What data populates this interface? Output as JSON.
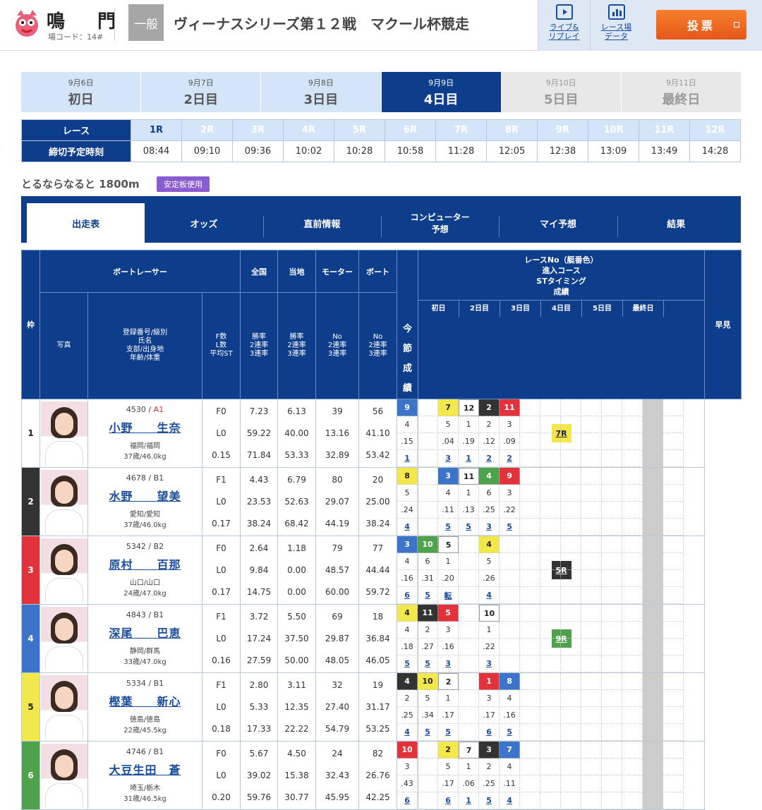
{
  "header": {
    "venue": "鳴　門",
    "code": "場コード：14#",
    "grade": "一般",
    "title": "ヴィーナスシリーズ第１２戦　マクール杯競走",
    "live_label": "ライブ&\nリプレイ",
    "data_label": "レース場\nデータ",
    "vote_label": "投票"
  },
  "days": [
    {
      "date": "9月6日",
      "name": "初日",
      "state": "past"
    },
    {
      "date": "9月7日",
      "name": "2日目",
      "state": "past"
    },
    {
      "date": "9月8日",
      "name": "3日目",
      "state": "past"
    },
    {
      "date": "9月9日",
      "name": "4日目",
      "state": "cur"
    },
    {
      "date": "9月10日",
      "name": "5日目",
      "state": "fut"
    },
    {
      "date": "9月11日",
      "name": "最終日",
      "state": "fut"
    }
  ],
  "race_row_label": "レース",
  "time_row_label": "締切予定時刻",
  "races": [
    "1R",
    "2R",
    "3R",
    "4R",
    "5R",
    "6R",
    "7R",
    "8R",
    "9R",
    "10R",
    "11R",
    "12R"
  ],
  "times": [
    "08:44",
    "09:10",
    "09:36",
    "10:02",
    "10:28",
    "10:58",
    "11:28",
    "12:05",
    "12:38",
    "13:09",
    "13:49",
    "14:28"
  ],
  "course": "とるならなると 1800m",
  "stab": "安定板使用",
  "tabs": [
    "出走表",
    "オッズ",
    "直前情報",
    "コンピューター\n予想",
    "マイ予想",
    "結果"
  ],
  "table_headers": {
    "waku": "枠",
    "boat_racer": "ボートレーサー",
    "photo": "写真",
    "reg": "登録番号/級別\n氏名\n支部/出身地\n年齢/体重",
    "fl": "F数\nL数\n平均ST",
    "zenkoku": "全国",
    "touchi": "当地",
    "motor": "モーター",
    "boat": "ボート",
    "rate": "勝率\n2連率\n3連率",
    "no_rate": "No\n2連率\n3連率",
    "race_info": "レースNo（艇番色）\n進入コース\nSTタイミング\n成績",
    "konsetsu": "今\n節\n成\n績",
    "hayami": "早見",
    "day_cols": [
      "初日",
      "2日目",
      "3日目",
      "4日目",
      "5日目",
      "最終日"
    ]
  },
  "racers": [
    {
      "waku": "1",
      "color": "#ffffff",
      "reg": "4530",
      "cls": "A1",
      "name": "小野　　生奈",
      "branch": "福岡/福岡",
      "age": "37歳/46.0kg",
      "f": "F0",
      "l": "L0",
      "st": "0.15",
      "nat": [
        "7.23",
        "59.22",
        "71.84"
      ],
      "loc": [
        "6.13",
        "40.00",
        "53.33"
      ],
      "mot": [
        "39",
        "13.16",
        "32.89"
      ],
      "bt": [
        "56",
        "41.10",
        "53.42"
      ],
      "hayami": "7R",
      "hcls": "b5",
      "rows": [
        [
          [
            "9",
            "b4"
          ],
          [
            "",
            ""
          ],
          [
            "7",
            "b5"
          ],
          [
            "12",
            "b1"
          ],
          [
            "2",
            "b2"
          ],
          [
            "11",
            "b3"
          ]
        ],
        [
          "4",
          "",
          "5",
          "1",
          "2",
          "3"
        ],
        [
          ".15",
          "",
          ".04",
          ".19",
          ".12",
          ".09"
        ],
        [
          "1",
          "",
          "3",
          "1",
          "2",
          "2"
        ]
      ]
    },
    {
      "waku": "2",
      "color": "#333333",
      "reg": "4678",
      "cls": "B1",
      "name": "水野　　望美",
      "branch": "愛知/愛知",
      "age": "37歳/46.0kg",
      "f": "F1",
      "l": "L0",
      "st": "0.17",
      "nat": [
        "4.43",
        "23.53",
        "38.24"
      ],
      "loc": [
        "6.79",
        "52.63",
        "68.42"
      ],
      "mot": [
        "80",
        "29.07",
        "44.19"
      ],
      "bt": [
        "20",
        "25.00",
        "38.24"
      ],
      "hayami": "",
      "hcls": "",
      "rows": [
        [
          [
            "8",
            "b5"
          ],
          [
            "",
            ""
          ],
          [
            "3",
            "b4"
          ],
          [
            "11",
            "b1"
          ],
          [
            "4",
            "b6"
          ],
          [
            "9",
            "b3"
          ]
        ],
        [
          "5",
          "",
          "4",
          "1",
          "6",
          "3"
        ],
        [
          ".24",
          "",
          ".11",
          ".13",
          ".25",
          ".22"
        ],
        [
          "4",
          "",
          "5",
          "5",
          "3",
          "5"
        ]
      ]
    },
    {
      "waku": "3",
      "color": "#e2323c",
      "reg": "5342",
      "cls": "B2",
      "name": "原村　　百那",
      "branch": "山口/山口",
      "age": "24歳/47.0kg",
      "f": "F0",
      "l": "L0",
      "st": "0.17",
      "nat": [
        "2.64",
        "9.84",
        "14.75"
      ],
      "loc": [
        "1.18",
        "0.00",
        "0.00"
      ],
      "mot": [
        "79",
        "48.57",
        "60.00"
      ],
      "bt": [
        "77",
        "44.44",
        "59.72"
      ],
      "hayami": "5R",
      "hcls": "b2",
      "rows": [
        [
          [
            "3",
            "b4"
          ],
          [
            "10",
            "b6"
          ],
          [
            "5",
            "b1"
          ],
          [
            "",
            ""
          ],
          [
            "4",
            "b5"
          ],
          [
            "",
            ""
          ]
        ],
        [
          "4",
          "6",
          "1",
          "",
          "5",
          ""
        ],
        [
          ".16",
          ".31",
          ".20",
          "",
          ".26",
          ""
        ],
        [
          "6",
          "5",
          "転",
          "",
          "4",
          ""
        ]
      ]
    },
    {
      "waku": "4",
      "color": "#3b74c9",
      "reg": "4843",
      "cls": "B1",
      "name": "深尾　　巴恵",
      "branch": "静岡/群馬",
      "age": "33歳/47.0kg",
      "f": "F1",
      "l": "L0",
      "st": "0.16",
      "nat": [
        "3.72",
        "17.24",
        "27.59"
      ],
      "loc": [
        "5.50",
        "37.50",
        "50.00"
      ],
      "mot": [
        "69",
        "29.87",
        "48.05"
      ],
      "bt": [
        "18",
        "36.84",
        "46.05"
      ],
      "hayami": "9R",
      "hcls": "b6",
      "rows": [
        [
          [
            "4",
            "b5"
          ],
          [
            "11",
            "b2"
          ],
          [
            "5",
            "b3"
          ],
          [
            "",
            ""
          ],
          [
            "10",
            "b1"
          ],
          [
            "",
            ""
          ]
        ],
        [
          "4",
          "2",
          "3",
          "",
          "1",
          ""
        ],
        [
          ".18",
          ".27",
          ".16",
          "",
          ".22",
          ""
        ],
        [
          "5",
          "5",
          "3",
          "",
          "3",
          ""
        ]
      ]
    },
    {
      "waku": "5",
      "color": "#f2e84c",
      "reg": "5334",
      "cls": "B1",
      "name": "樫葉　　新心",
      "branch": "徳島/徳島",
      "age": "22歳/45.5kg",
      "f": "F1",
      "l": "L0",
      "st": "0.18",
      "nat": [
        "2.80",
        "5.33",
        "17.33"
      ],
      "loc": [
        "3.11",
        "12.35",
        "22.22"
      ],
      "mot": [
        "32",
        "27.40",
        "54.79"
      ],
      "bt": [
        "19",
        "31.17",
        "53.25"
      ],
      "hayami": "",
      "hcls": "",
      "rows": [
        [
          [
            "4",
            "b2"
          ],
          [
            "10",
            "b5"
          ],
          [
            "2",
            "b1"
          ],
          [
            "",
            ""
          ],
          [
            "1",
            "b3"
          ],
          [
            "8",
            "b4"
          ]
        ],
        [
          "2",
          "5",
          "1",
          "",
          "3",
          "4"
        ],
        [
          ".25",
          ".34",
          ".17",
          "",
          ".17",
          ".16"
        ],
        [
          "4",
          "5",
          "5",
          "",
          "6",
          "5"
        ]
      ]
    },
    {
      "waku": "6",
      "color": "#4ea24c",
      "reg": "4746",
      "cls": "B1",
      "name": "大豆生田　蒼",
      "branch": "埼玉/栃木",
      "age": "31歳/46.5kg",
      "f": "F0",
      "l": "L0",
      "st": "0.20",
      "nat": [
        "5.67",
        "39.02",
        "59.76"
      ],
      "loc": [
        "4.50",
        "15.38",
        "30.77"
      ],
      "mot": [
        "24",
        "32.43",
        "45.95"
      ],
      "bt": [
        "82",
        "26.76",
        "42.25"
      ],
      "hayami": "",
      "hcls": "",
      "rows": [
        [
          [
            "10",
            "b3"
          ],
          [
            "",
            ""
          ],
          [
            "2",
            "b5"
          ],
          [
            "7",
            "b1"
          ],
          [
            "3",
            "b2"
          ],
          [
            "7",
            "b4"
          ]
        ],
        [
          "3",
          "",
          "5",
          "1",
          "2",
          "4"
        ],
        [
          ".43",
          "",
          ".17",
          ".06",
          ".25",
          ".11"
        ],
        [
          "6",
          "",
          "6",
          "1",
          "5",
          "4"
        ]
      ]
    }
  ]
}
